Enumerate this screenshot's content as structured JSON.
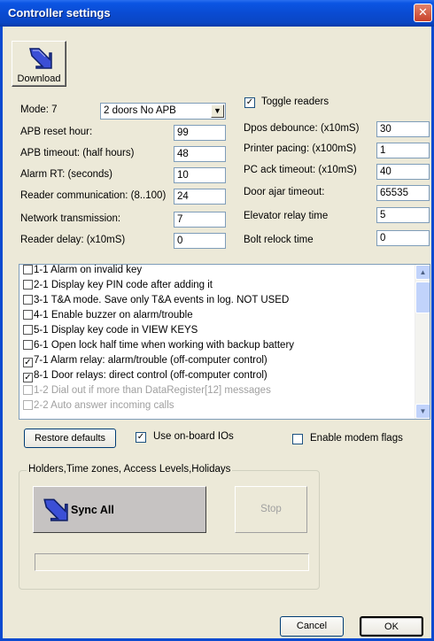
{
  "window": {
    "title": "Controller settings",
    "close_icon": "close-icon",
    "titlebar_color": "#0a4bd2"
  },
  "toolbar": {
    "download_label": "Download",
    "download_icon": "download-arrow-icon"
  },
  "mode": {
    "label": "Mode: 7",
    "selected": "2 doors No APB"
  },
  "left_fields": [
    {
      "label": "APB reset hour:",
      "value": "99"
    },
    {
      "label": "APB timeout: (half hours)",
      "value": "48"
    },
    {
      "label": "Alarm RT: (seconds)",
      "value": "10"
    },
    {
      "label": "Reader communication: (8..100)",
      "value": "24"
    },
    {
      "label": "Network transmission:",
      "value": "7"
    },
    {
      "label": "Reader delay: (x10mS)",
      "value": "0"
    }
  ],
  "toggle_readers": {
    "label": "Toggle readers",
    "checked": true
  },
  "right_fields": [
    {
      "label": "Dpos debounce: (x10mS)",
      "value": "30"
    },
    {
      "label": "Printer pacing: (x100mS)",
      "value": "1"
    },
    {
      "label": "PC ack timeout: (x10mS)",
      "value": "40"
    },
    {
      "label": "Door ajar timeout:",
      "value": "65535"
    },
    {
      "label": "Elevator relay time",
      "value": "5"
    },
    {
      "label": "Bolt relock time",
      "value": "0"
    }
  ],
  "flags_list": [
    {
      "label": "1-1 Alarm on invalid key",
      "checked": false,
      "disabled": false
    },
    {
      "label": "2-1 Display key PIN code after adding it",
      "checked": false,
      "disabled": false
    },
    {
      "label": "3-1 T&A mode. Save only T&A events in log. NOT USED",
      "checked": false,
      "disabled": false
    },
    {
      "label": "4-1 Enable buzzer on alarm/trouble",
      "checked": false,
      "disabled": false
    },
    {
      "label": "5-1 Display key code in VIEW KEYS",
      "checked": false,
      "disabled": false
    },
    {
      "label": "6-1 Open lock half time when working with backup battery",
      "checked": false,
      "disabled": false
    },
    {
      "label": "7-1 Alarm relay: alarm/trouble (off-computer control)",
      "checked": true,
      "disabled": false
    },
    {
      "label": "8-1 Door relays: direct control (off-computer control)",
      "checked": true,
      "disabled": false
    },
    {
      "label": "1-2 Dial out if more than DataRegister[12] messages",
      "checked": false,
      "disabled": true
    },
    {
      "label": "2-2 Auto answer incoming calls",
      "checked": false,
      "disabled": true
    }
  ],
  "restore_defaults_label": "Restore defaults",
  "use_onboard_ios": {
    "label": "Use on-board IOs",
    "checked": true
  },
  "enable_modem_flags": {
    "label": "Enable modem flags",
    "checked": false
  },
  "sync_group": {
    "legend": "Holders,Time zones, Access Levels,Holidays",
    "sync_label": "Sync All",
    "stop_label": "Stop",
    "progress": 0
  },
  "footer": {
    "cancel_label": "Cancel",
    "ok_label": "OK"
  }
}
